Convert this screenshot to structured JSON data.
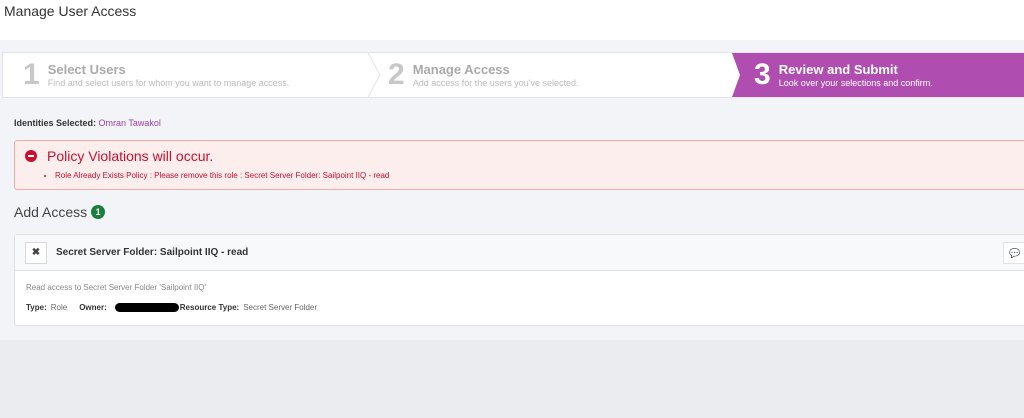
{
  "page_title": "Manage User Access",
  "steps": [
    {
      "number": "1",
      "title": "Select Users",
      "description": "Find and select users for whom you want to manage access."
    },
    {
      "number": "2",
      "title": "Manage Access",
      "description": "Add access for the users you've selected."
    },
    {
      "number": "3",
      "title": "Review and Submit",
      "description": "Look over your selections and confirm."
    }
  ],
  "identities": {
    "label": "Identities Selected:",
    "value": "Omran Tawakol"
  },
  "alert": {
    "title": "Policy Violations will occur.",
    "items": [
      "Role Already Exists Policy : Please remove this role : Secret Server Folder: Sailpoint IIQ - read"
    ]
  },
  "add_access": {
    "title": "Add Access",
    "count": "1"
  },
  "card": {
    "remove": "✖",
    "title": "Secret Server Folder: Sailpoint IIQ - read",
    "comment_icon": "💬",
    "description": "Read access to Secret Server Folder 'Sailpoint IIQ'",
    "type_label": "Type:",
    "type_value": "Role",
    "owner_label": "Owner:",
    "resource_type_label": "Resource Type:",
    "resource_type_value": "Secret Server Folder"
  },
  "colors": {
    "accent": "#b04db0",
    "error": "#c8102e",
    "badge": "#1a7f3a"
  }
}
